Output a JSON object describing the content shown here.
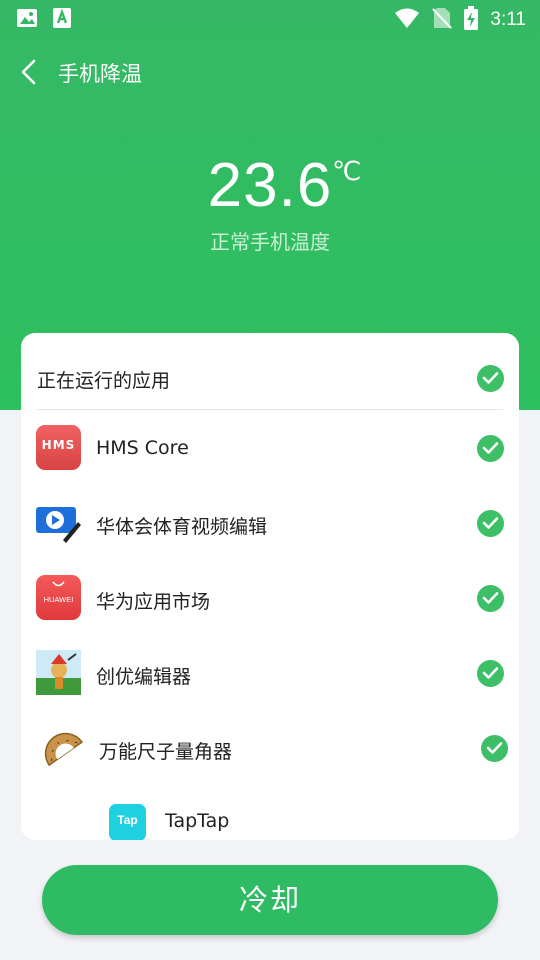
{
  "status_bar": {
    "time": "3:11"
  },
  "nav": {
    "title": "手机降温"
  },
  "temperature": {
    "value": "23.6",
    "unit": "℃",
    "caption": "正常手机温度"
  },
  "running_apps": {
    "header": "正在运行的应用",
    "apps": [
      {
        "name": "HMS Core",
        "icon": "hms-core-icon"
      },
      {
        "name": "华体会体育视频编辑",
        "icon": "video-editor-icon"
      },
      {
        "name": "华为应用市场",
        "icon": "huawei-appgallery-icon"
      },
      {
        "name": "创优编辑器",
        "icon": "chuangyou-editor-icon"
      },
      {
        "name": "万能尺子量角器",
        "icon": "protractor-icon"
      },
      {
        "name": "TapTap",
        "icon": "taptap-icon"
      }
    ]
  },
  "icon_text": {
    "hms": "HMS",
    "huawei": "HUAWEI",
    "tap": "Tap"
  },
  "colors": {
    "header_green": "#2ec05e",
    "check_green": "#3cbf66",
    "button_green": "#2fbb63"
  },
  "action": {
    "cool_label": "冷却"
  }
}
